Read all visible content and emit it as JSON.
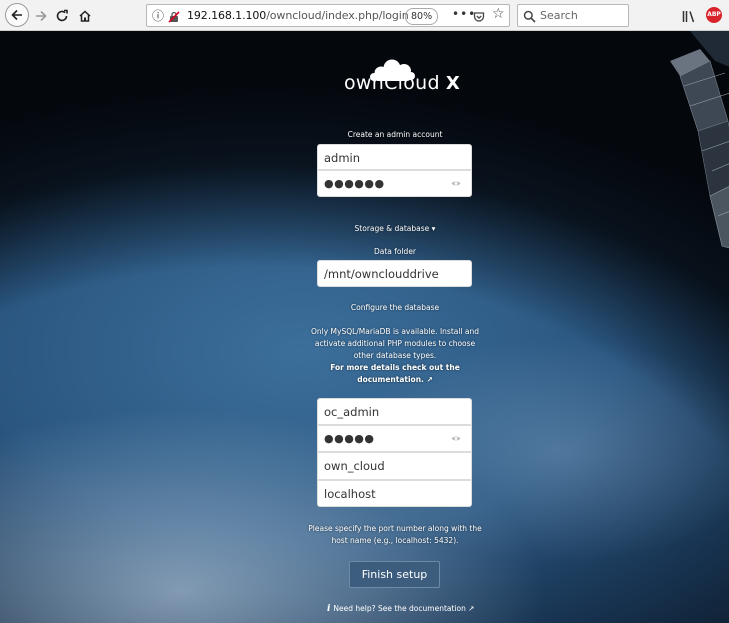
{
  "browser": {
    "url_host": "192.168.1.100",
    "url_path": "/owncloud/index.php/login",
    "zoom": "80%",
    "search_placeholder": "Search",
    "abp_label": "ABP"
  },
  "logo": {
    "text": "ownCloud",
    "x": "X"
  },
  "admin": {
    "heading": "Create an admin account",
    "username": "admin",
    "password_mask": "●●●●●●"
  },
  "storage": {
    "toggle_label": "Storage & database ▾",
    "data_folder_label": "Data folder",
    "data_folder_value": "/mnt/ownclouddrive"
  },
  "database": {
    "heading": "Configure the database",
    "note_line1": "Only MySQL/MariaDB is available. Install and activate additional PHP modules to choose other database types.",
    "note_line2": "For more details check out the documentation. ↗",
    "db_user": "oc_admin",
    "db_password_mask": "●●●●●",
    "db_name": "own_cloud",
    "db_host": "localhost",
    "port_hint": "Please specify the port number along with the host name (e.g., localhost: 5432)."
  },
  "actions": {
    "finish_label": "Finish setup",
    "help_label": "Need help? See the documentation ↗"
  }
}
